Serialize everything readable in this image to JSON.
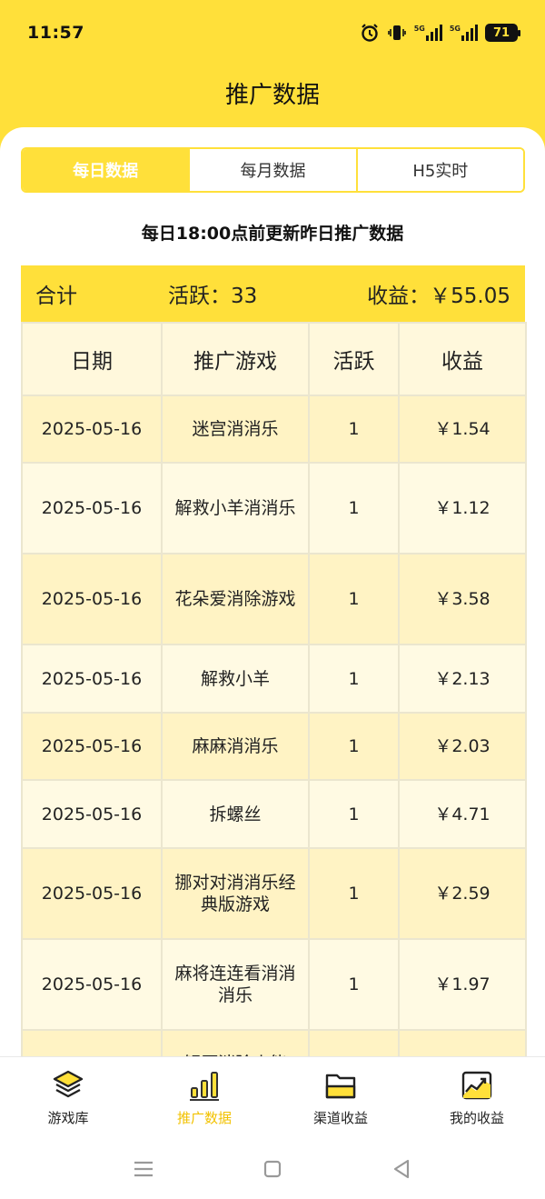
{
  "status_bar": {
    "time": "11:57",
    "battery": "71",
    "network_label": "5G",
    "icons": [
      "alarm-icon",
      "vibrate-icon",
      "signal-5g-icon",
      "signal-5g-icon",
      "battery-icon"
    ]
  },
  "header": {
    "title": "推广数据"
  },
  "tabs": [
    {
      "label": "每日数据",
      "active": true
    },
    {
      "label": "每月数据",
      "active": false
    },
    {
      "label": "H5实时",
      "active": false
    }
  ],
  "notice": "每日18:00点前更新昨日推广数据",
  "summary": {
    "label": "合计",
    "active_text": "活跃：33",
    "income_text": "收益：￥55.05"
  },
  "table": {
    "headers": [
      "日期",
      "推广游戏",
      "活跃",
      "收益"
    ],
    "rows": [
      {
        "date": "2025-05-16",
        "game": "迷宫消消乐",
        "active": "1",
        "income": "￥1.54"
      },
      {
        "date": "2025-05-16",
        "game": "解救小羊消消乐",
        "active": "1",
        "income": "￥1.12"
      },
      {
        "date": "2025-05-16",
        "game": "花朵爱消除游戏",
        "active": "1",
        "income": "￥3.58"
      },
      {
        "date": "2025-05-16",
        "game": "解救小羊",
        "active": "1",
        "income": "￥2.13"
      },
      {
        "date": "2025-05-16",
        "game": "麻麻消消乐",
        "active": "1",
        "income": "￥2.03"
      },
      {
        "date": "2025-05-16",
        "game": "拆螺丝",
        "active": "1",
        "income": "￥4.71"
      },
      {
        "date": "2025-05-16",
        "game": "挪对对消消乐经典版游戏",
        "active": "1",
        "income": "￥2.59"
      },
      {
        "date": "2025-05-16",
        "game": "麻将连连看消消消乐",
        "active": "1",
        "income": "￥1.97"
      },
      {
        "date": "",
        "game": "解压消除小能",
        "active": "",
        "income": ""
      }
    ]
  },
  "nav": [
    {
      "label": "游戏库",
      "icon": "layers-icon",
      "active": false
    },
    {
      "label": "推广数据",
      "icon": "bar-chart-icon",
      "active": true
    },
    {
      "label": "渠道收益",
      "icon": "folder-icon",
      "active": false
    },
    {
      "label": "我的收益",
      "icon": "trend-chart-icon",
      "active": false
    }
  ],
  "colors": {
    "accent": "#ffe03a",
    "active_nav": "#f2c200",
    "row_odd": "#fff3c4",
    "row_even": "#fffae3"
  }
}
